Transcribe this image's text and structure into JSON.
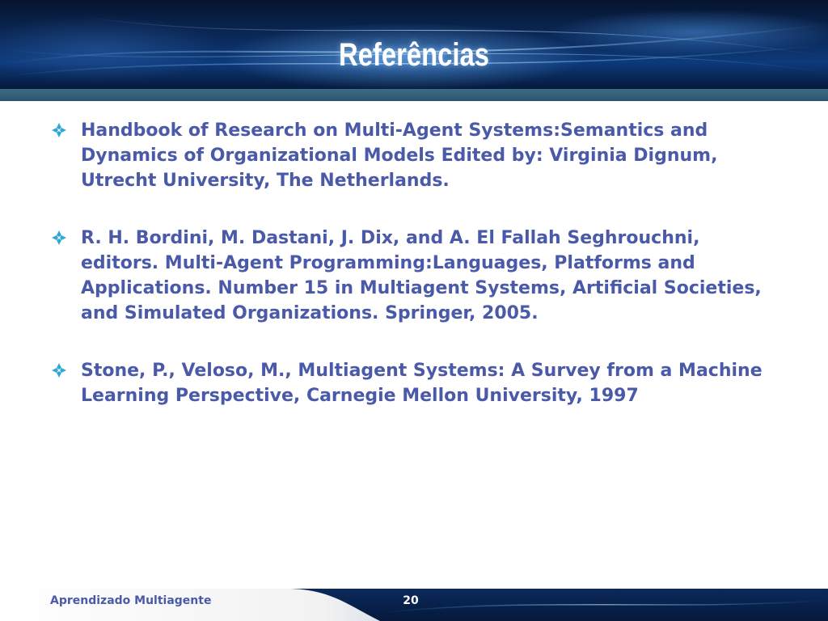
{
  "slide": {
    "title": "Referências",
    "references": [
      {
        "text": "Handbook of Research on Multi-Agent  Systems:Semantics and Dynamics of Organizational Models Edited by: Virginia Dignum, Utrecht University, The Netherlands."
      },
      {
        "text": "R. H. Bordini, M. Dastani, J. Dix, and A. El Fallah Seghrouchni, editors. Multi-Agent Programming:Languages, Platforms and Applications. Number 15 in Multiagent Systems, Artificial Societies, and Simulated Organizations. Springer, 2005."
      },
      {
        "text": "Stone, P., Veloso, M., Multiagent Systems: A Survey from a Machine Learning Perspective, Carnegie Mellon University, 1997"
      }
    ],
    "bullet_icon": "diamond-bullet-icon",
    "footer": {
      "course": "Aprendizado Multiagente",
      "page_number": "20"
    }
  },
  "colors": {
    "text": "#4a5aa8",
    "bullet": "#2fa8d8",
    "header_dark": "#06142e",
    "header_mid": "#0d3a7a",
    "strip": "#3e6a86"
  }
}
